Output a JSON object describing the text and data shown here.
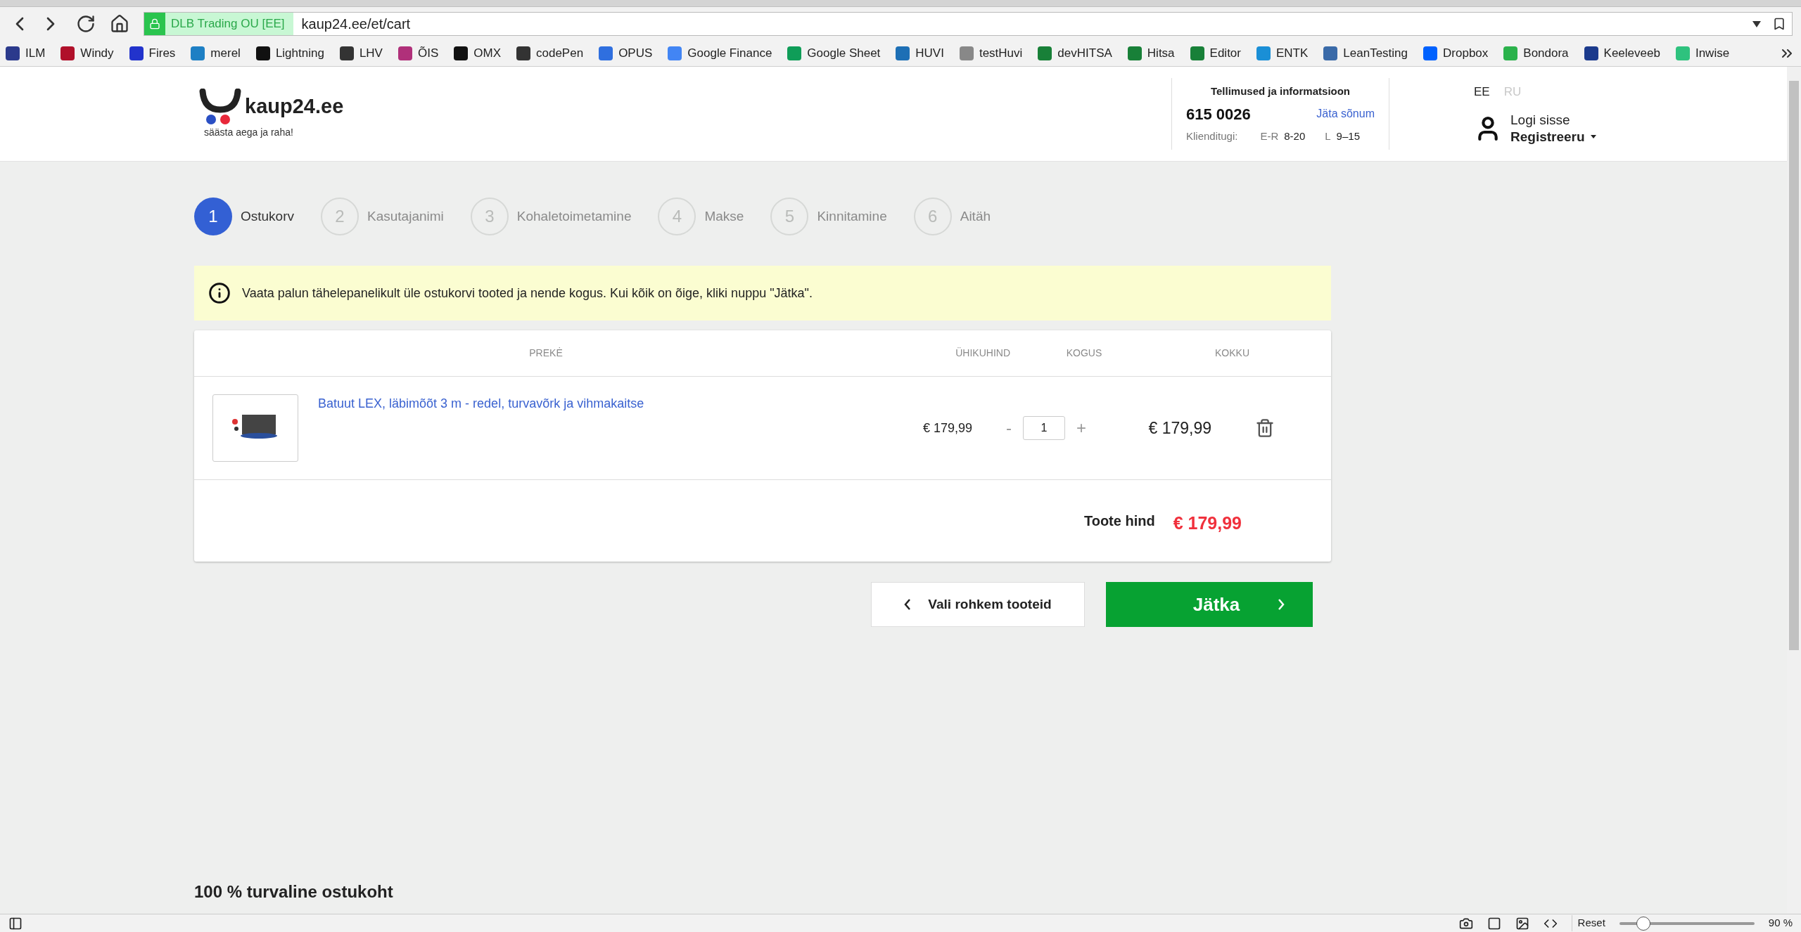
{
  "browser": {
    "site_identity": "DLB Trading OU [EE]",
    "url": "kaup24.ee/et/cart",
    "bookmarks": [
      "ILM",
      "Windy",
      "Fires",
      "merel",
      "Lightning",
      "LHV",
      "ÕIS",
      "OMX",
      "codePen",
      "OPUS",
      "Google Finance",
      "Google Sheet",
      "HUVI",
      "testHuvi",
      "devHITSA",
      "Hitsa",
      "Editor",
      "ENTK",
      "LeanTesting",
      "Dropbox",
      "Bondora",
      "Keeleveeb",
      "Inwise"
    ]
  },
  "header": {
    "logo": "kaup24.ee",
    "tagline": "säästa aega ja raha!",
    "info_title": "Tellimused ja informatsioon",
    "phone": "615 0026",
    "message_link": "Jäta sõnum",
    "support_label": "Klienditugi:",
    "hours": [
      {
        "days": "E-R",
        "time": "8-20"
      },
      {
        "days": "L",
        "time": "9–15"
      }
    ],
    "languages": [
      {
        "label": "EE",
        "selected": true
      },
      {
        "label": "RU",
        "selected": false
      }
    ],
    "login": "Logi sisse",
    "register": "Registreeru"
  },
  "steps": [
    {
      "number": "1",
      "label": "Ostukorv",
      "selected": true
    },
    {
      "number": "2",
      "label": "Kasutajanimi",
      "selected": false
    },
    {
      "number": "3",
      "label": "Kohaletoimetamine",
      "selected": false
    },
    {
      "number": "4",
      "label": "Makse",
      "selected": false
    },
    {
      "number": "5",
      "label": "Kinnitamine",
      "selected": false
    },
    {
      "number": "6",
      "label": "Aitäh",
      "selected": false
    }
  ],
  "notice": "Vaata palun tähelepanelikult üle ostukorvi tooted ja nende kogus. Kui kõik on õige, kliki nuppu \"Jätka\".",
  "table": {
    "columns": [
      "PREKĖ",
      "ÜHIKUHIND",
      "KOGUS",
      "KOKKU"
    ],
    "rows": [
      {
        "name": "Batuut LEX, läbimõõt 3 m - redel, turvavõrk ja vihmakaitse",
        "unit_price": "€ 179,99",
        "minus": "-",
        "quantity": "1",
        "plus": "+",
        "total": "€ 179,99"
      }
    ],
    "total_label": "Toote hind",
    "total_value": "€ 179,99"
  },
  "buttons": {
    "back": "Vali rohkem tooteid",
    "continue": "Jätka"
  },
  "footer": "100 % turvaline ostukoht",
  "status_bar": {
    "reset": "Reset",
    "zoom": {
      "level": 0.18
    },
    "zoom_reading": "90 %"
  }
}
